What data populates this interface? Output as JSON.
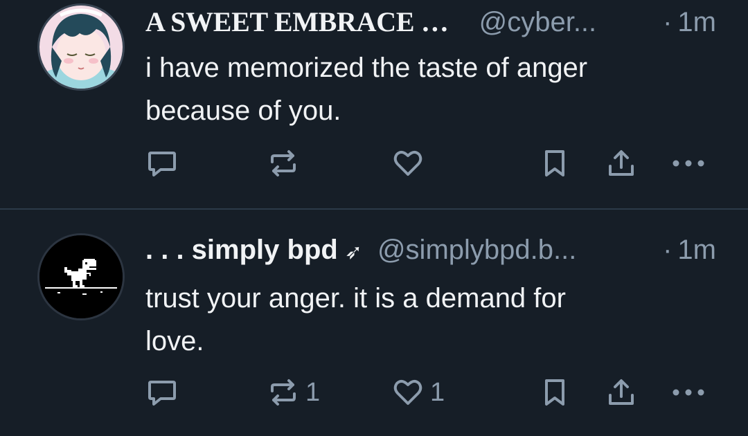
{
  "posts": [
    {
      "display_name": "A SWEET EMBRACE …",
      "handle": "@cyber...",
      "separator": "·",
      "time": "1m",
      "text_lines": [
        "i have memorized the taste of anger",
        "because of you."
      ],
      "repost_count": "",
      "like_count": ""
    },
    {
      "display_name": ". . . simply bpd",
      "name_badge_icon": "arrow-icon",
      "name_badge_glyph": "➶",
      "handle": "@simplybpd.b...",
      "separator": "·",
      "time": "1m",
      "text_lines": [
        "trust your anger. it is a demand for",
        "love."
      ],
      "repost_count": "1",
      "like_count": "1"
    }
  ],
  "colors": {
    "background": "#161e27",
    "text": "#f1f3f5",
    "muted": "#8c9cad",
    "divider": "#2c3a49"
  }
}
